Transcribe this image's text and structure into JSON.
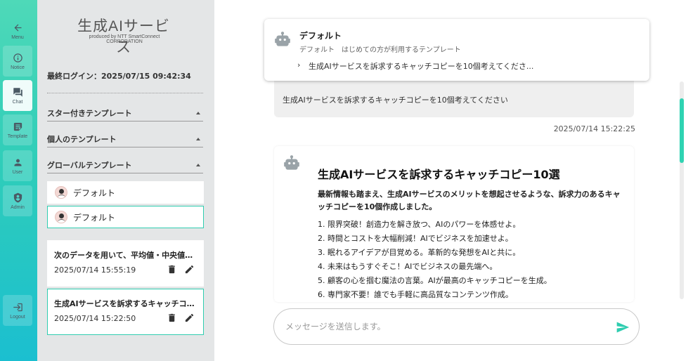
{
  "rail": {
    "menu_label": "Menu",
    "notice_label": "Notice",
    "chat_label": "Chat",
    "template_label": "Template",
    "user_label": "User",
    "admin_label": "Admin",
    "logout_label": "Logout"
  },
  "sidebar": {
    "app_title": "生成AIサービス",
    "app_subtitle": "produced by NTT SmartConnect CORPORATION",
    "last_login": "最終ログイン：2025/07/15 09:42:34",
    "sections": {
      "starred": "スター付きテンプレート",
      "personal": "個人のテンプレート",
      "global": "グローバルテンプレート"
    },
    "templates": [
      {
        "label": "デフォルト"
      },
      {
        "label": "デフォルト"
      }
    ],
    "history": [
      {
        "title": "次のデータを用いて、平均値・中央値…",
        "date": "2025/07/14 15:55:19"
      },
      {
        "title": "生成AIサービスを訴求するキャッチコ…",
        "date": "2025/07/14 15:22:50"
      }
    ]
  },
  "main": {
    "template_card": {
      "name": "デフォルト",
      "description": "デフォルト　はじめての方が利用するテンプレート",
      "prompt_caret": "›",
      "prompt": "生成AIサービスを訴求するキャッチコピーを10個考えてくださ..."
    },
    "user_message": {
      "text": "生成AIサービスを訴求するキャッチコピーを10個考えてください",
      "time": "2025/07/14 15:22:25"
    },
    "ai_message": {
      "heading": "生成AIサービスを訴求するキャッチコピー10選",
      "intro": "最新情報も踏まえ、生成AIサービスのメリットを想起させるような、訴求力のあるキャッチコピーを10個作成しました。",
      "items": [
        "1. 限界突破！創造力を解き放つ、AIのパワーを体感せよ。",
        "2. 時間とコストを大幅削減！AIでビジネスを加速せよ。",
        "3. 眠れるアイデアが目覚める。革新的な発想をAIと共に。",
        "4. 未来はもうすぐそこ！AIでビジネスの最先端へ。",
        "5. 顧客の心を掴む魔法の言葉。AIが最高のキャッチコピーを生成。",
        "6. 専門家不要！誰でも手軽に高品質なコンテンツ作成。"
      ]
    },
    "composer": {
      "placeholder": "メッセージを送信します。"
    }
  },
  "colors": {
    "accent": "#2fcdb0",
    "rail_top": "#4ed9b8",
    "rail_bottom": "#1bbfd0",
    "sidebar_bg": "#e4e6e7"
  },
  "icons": {
    "menu": "arrow-left-icon",
    "notice": "info-icon",
    "chat": "chat-icon",
    "template": "template-icon",
    "user": "user-icon",
    "admin": "admin-shield-icon",
    "logout": "logout-icon",
    "bot": "robot-icon",
    "delete": "trash-icon",
    "edit": "pencil-icon",
    "send": "send-icon"
  }
}
